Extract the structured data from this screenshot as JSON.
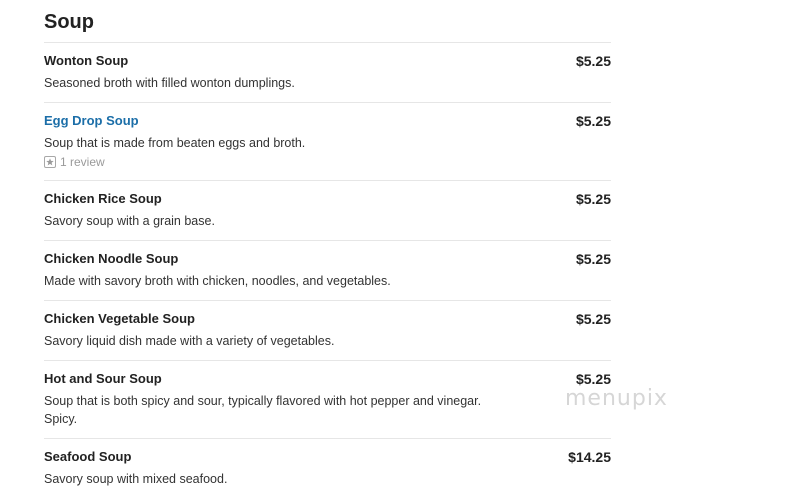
{
  "section": {
    "title": "Soup"
  },
  "items": [
    {
      "name": "Wonton Soup",
      "price": "$5.25",
      "desc": "Seasoned broth with filled wonton dumplings."
    },
    {
      "name": "Egg Drop Soup",
      "price": "$5.25",
      "desc": "Soup that is made from beaten eggs and broth.",
      "review": "1 review",
      "review_icon": "star-badge-icon"
    },
    {
      "name": "Chicken Rice Soup",
      "price": "$5.25",
      "desc": "Savory soup with a grain base."
    },
    {
      "name": "Chicken Noodle Soup",
      "price": "$5.25",
      "desc": "Made with savory broth with chicken, noodles, and vegetables."
    },
    {
      "name": "Chicken Vegetable Soup",
      "price": "$5.25",
      "desc": "Savory liquid dish made with a variety of vegetables."
    },
    {
      "name": "Hot and Sour Soup",
      "price": "$5.25",
      "desc": "Soup that is both spicy and sour, typically flavored with hot pepper and vinegar. Spicy."
    },
    {
      "name": "Seafood Soup",
      "price": "$14.25",
      "desc": "Savory soup with mixed seafood."
    }
  ],
  "watermark": "menupix",
  "colors": {
    "link": "#1b6ea8",
    "divider": "#e6e6e6",
    "muted": "#9a9a9a"
  }
}
